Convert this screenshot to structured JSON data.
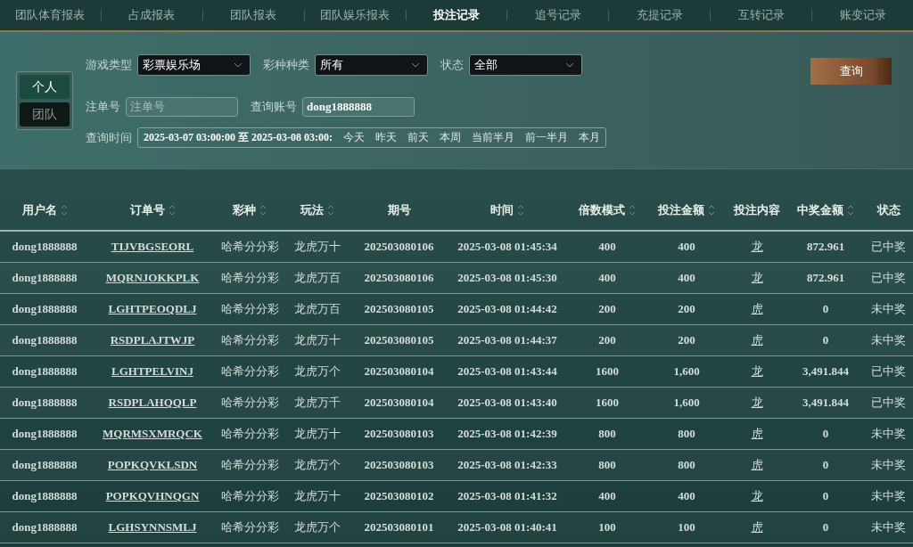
{
  "tabs": [
    {
      "label": "团队体育报表",
      "selected": false
    },
    {
      "label": "占成报表",
      "selected": false
    },
    {
      "label": "团队报表",
      "selected": false
    },
    {
      "label": "团队娱乐报表",
      "selected": false
    },
    {
      "label": "投注记录",
      "selected": true
    },
    {
      "label": "追号记录",
      "selected": false
    },
    {
      "label": "充提记录",
      "selected": false
    },
    {
      "label": "互转记录",
      "selected": false
    },
    {
      "label": "账变记录",
      "selected": false
    }
  ],
  "scope": [
    {
      "label": "个人",
      "selected": true
    },
    {
      "label": "团队",
      "selected": false
    }
  ],
  "filters": {
    "game_type": {
      "label": "游戏类型",
      "value": "彩票娱乐场"
    },
    "lottery_kind": {
      "label": "彩种种类",
      "value": "所有"
    },
    "status": {
      "label": "状态",
      "value": "全部"
    },
    "order_no": {
      "label": "注单号",
      "placeholder": "注单号"
    },
    "account": {
      "label": "查询账号",
      "value": "dong1888888"
    },
    "time": {
      "label": "查询时间",
      "value": "2025-03-07 03:00:00 至 2025-03-08 03:00:",
      "shortcuts": [
        "今天",
        "昨天",
        "前天",
        "本周",
        "当前半月",
        "前一半月",
        "本月"
      ]
    },
    "query_button": "查询"
  },
  "table": {
    "columns": [
      {
        "label": "用户名",
        "sortable": true,
        "kind": "text"
      },
      {
        "label": "订单号",
        "sortable": true,
        "kind": "link"
      },
      {
        "label": "彩种",
        "sortable": true,
        "kind": "text"
      },
      {
        "label": "玩法",
        "sortable": true,
        "kind": "text"
      },
      {
        "label": "期号",
        "sortable": false,
        "kind": "text"
      },
      {
        "label": "时间",
        "sortable": true,
        "kind": "text"
      },
      {
        "label": "倍数模式",
        "sortable": true,
        "kind": "text"
      },
      {
        "label": "投注金额",
        "sortable": true,
        "kind": "text"
      },
      {
        "label": "投注内容",
        "sortable": false,
        "kind": "link"
      },
      {
        "label": "中奖金额",
        "sortable": true,
        "kind": "text"
      },
      {
        "label": "状态",
        "sortable": false,
        "kind": "text"
      }
    ],
    "rows": [
      [
        "dong1888888",
        "TIJVBGSEORL",
        "哈希分分彩",
        "龙虎万十",
        "202503080106",
        "2025-03-08 01:45:34",
        "400",
        "400",
        "龙",
        "872.961",
        "已中奖"
      ],
      [
        "dong1888888",
        "MQRNJOKKPLK",
        "哈希分分彩",
        "龙虎万百",
        "202503080106",
        "2025-03-08 01:45:30",
        "400",
        "400",
        "龙",
        "872.961",
        "已中奖"
      ],
      [
        "dong1888888",
        "LGHTPEOQDLJ",
        "哈希分分彩",
        "龙虎万百",
        "202503080105",
        "2025-03-08 01:44:42",
        "200",
        "200",
        "虎",
        "0",
        "未中奖"
      ],
      [
        "dong1888888",
        "RSDPLAJTWJP",
        "哈希分分彩",
        "龙虎万十",
        "202503080105",
        "2025-03-08 01:44:37",
        "200",
        "200",
        "虎",
        "0",
        "未中奖"
      ],
      [
        "dong1888888",
        "LGHTPELVINJ",
        "哈希分分彩",
        "龙虎万个",
        "202503080104",
        "2025-03-08 01:43:44",
        "1600",
        "1,600",
        "龙",
        "3,491.844",
        "已中奖"
      ],
      [
        "dong1888888",
        "RSDPLAHQQLP",
        "哈希分分彩",
        "龙虎万千",
        "202503080104",
        "2025-03-08 01:43:40",
        "1600",
        "1,600",
        "龙",
        "3,491.844",
        "已中奖"
      ],
      [
        "dong1888888",
        "MQRMSXMRQCK",
        "哈希分分彩",
        "龙虎万十",
        "202503080103",
        "2025-03-08 01:42:39",
        "800",
        "800",
        "虎",
        "0",
        "未中奖"
      ],
      [
        "dong1888888",
        "POPKQVKLSDN",
        "哈希分分彩",
        "龙虎万个",
        "202503080103",
        "2025-03-08 01:42:33",
        "800",
        "800",
        "虎",
        "0",
        "未中奖"
      ],
      [
        "dong1888888",
        "POPKQVHNQGN",
        "哈希分分彩",
        "龙虎万十",
        "202503080102",
        "2025-03-08 01:41:32",
        "400",
        "400",
        "龙",
        "0",
        "未中奖"
      ],
      [
        "dong1888888",
        "LGHSYNNSMLJ",
        "哈希分分彩",
        "龙虎万个",
        "202503080101",
        "2025-03-08 01:40:41",
        "100",
        "100",
        "虎",
        "0",
        "未中奖"
      ]
    ]
  }
}
